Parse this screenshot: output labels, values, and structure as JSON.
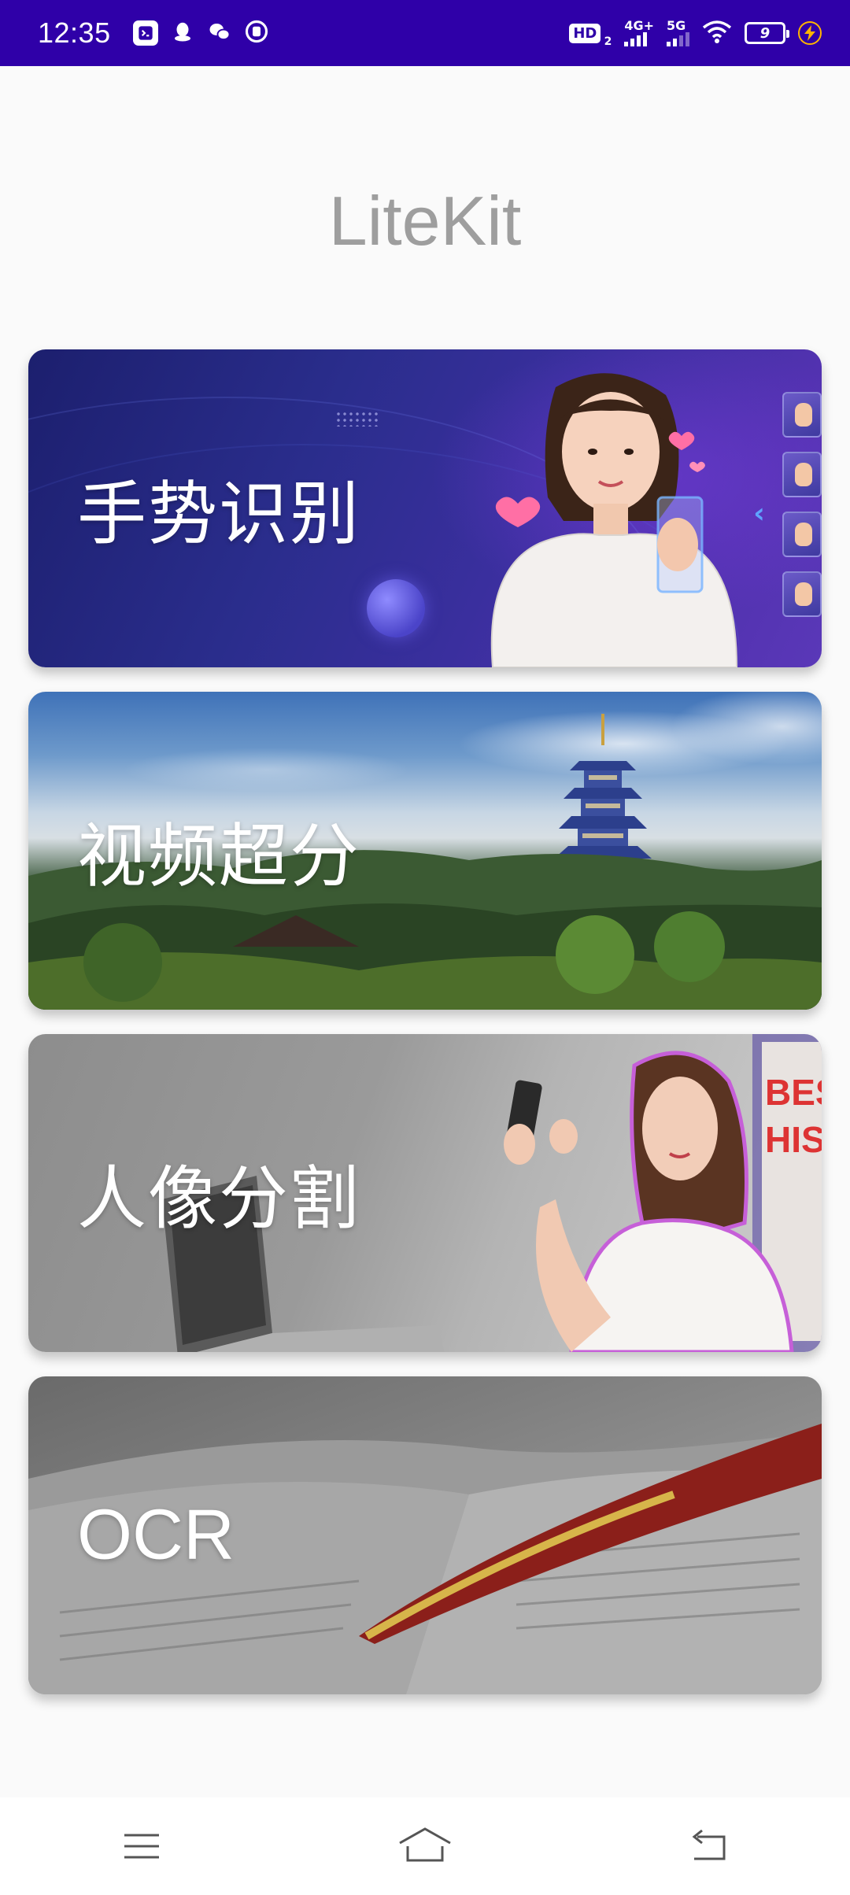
{
  "status_bar": {
    "time": "12:35",
    "hd_label": "HD",
    "hd_sub": "2",
    "net1_label": "4G+",
    "net2_label": "5G",
    "battery_level": "9"
  },
  "app": {
    "title": "LiteKit"
  },
  "cards": [
    {
      "label": "手势识别"
    },
    {
      "label": "视频超分"
    },
    {
      "label": "人像分割"
    },
    {
      "label": "OCR"
    }
  ],
  "colors": {
    "status_bar_bg": "#2f00a8",
    "title_color": "#9e9e9e",
    "page_bg": "#fafafa"
  },
  "nav_bar": {
    "menu_icon": "menu-icon",
    "home_icon": "home-icon",
    "back_icon": "back-icon"
  }
}
